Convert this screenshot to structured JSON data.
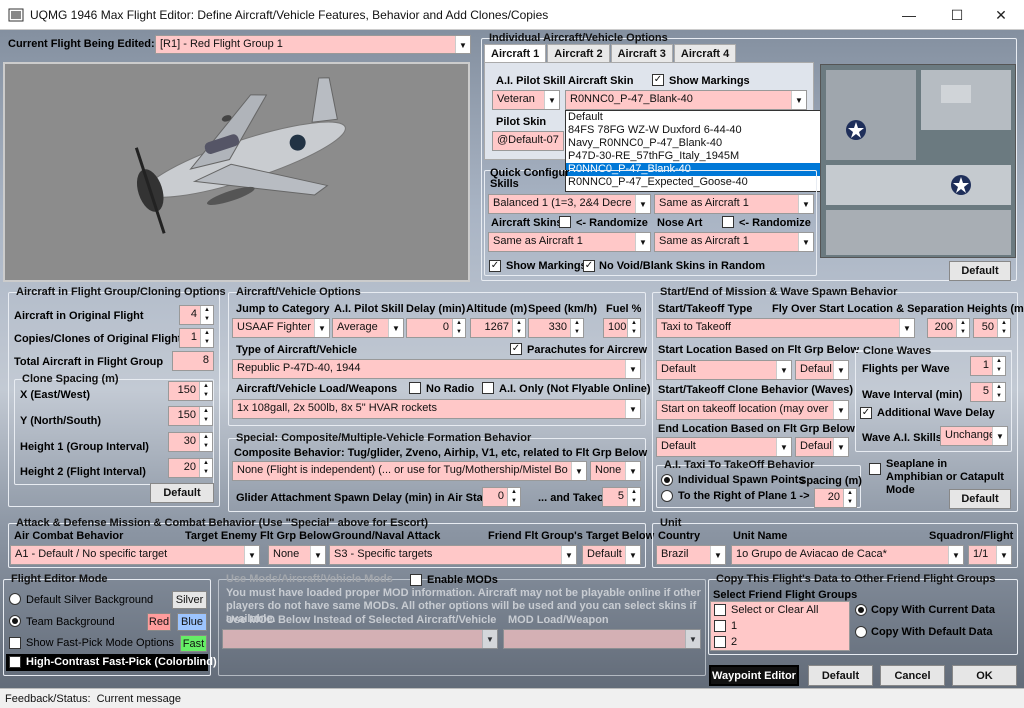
{
  "window": {
    "title": "UQMG 1946 Max Flight Editor:  Define Aircraft/Vehicle Features, Behavior and Add Clones/Copies",
    "minimize": "—",
    "maximize": "☐",
    "close": "✕"
  },
  "current_flight": {
    "label": "Current Flight Being Edited:",
    "value": "[R1] -  Red Flight Group  1"
  },
  "individual": {
    "title": "Individual Aircraft/Vehicle Options",
    "tabs": [
      "Aircraft 1",
      "Aircraft 2",
      "Aircraft 3",
      "Aircraft 4"
    ],
    "ai_skill_label": "A.I. Pilot Skill",
    "ai_skill": "Veteran",
    "skin_label": "Aircraft Skin",
    "show_markings": "Show Markings",
    "skin_value": "R0NNC0_P-47_Blank-40",
    "pilot_skin_label": "Pilot Skin",
    "pilot_skin": "@Default-07",
    "skin_options": [
      "Default",
      "84FS 78FG WZ-W Duxford 6-44-40",
      "Navy_R0NNC0_P-47_Blank-40",
      "P47D-30-RE_57thFG_Italy_1945M",
      "R0NNC0_P-47_Blank-40",
      "R0NNC0_P-47_Expected_Goose-40"
    ],
    "default_btn": "Default"
  },
  "quick": {
    "title": "Quick Configur",
    "skills": "Skills",
    "skills_val": "Balanced 1 (1=3, 2&4 Decre",
    "same1": "Same as Aircraft 1",
    "skins_label": "Aircraft Skins",
    "randomize": "<- Randomize",
    "skins_val": "Same as Aircraft 1",
    "nose_label": "Nose Art",
    "nose_val": "Same as Aircraft 1",
    "show_markings": "Show Markings",
    "no_void": "No Void/Blank Skins in Random"
  },
  "cloning": {
    "title": "Aircraft in Flight Group/Cloning Options",
    "orig_label": "Aircraft in Original Flight",
    "orig_val": "4",
    "copies_label": "Copies/Clones of Original Flight",
    "copies_val": "1",
    "total_label": "Total Aircraft in Flight Group",
    "total_val": "8",
    "spacing_title": "Clone Spacing (m)",
    "x_label": "X (East/West)",
    "x_val": "150",
    "y_label": "Y (North/South)",
    "y_val": "150",
    "h1_label": "Height 1 (Group Interval)",
    "h1_val": "30",
    "h2_label": "Height 2 (Flight Interval)",
    "h2_val": "20",
    "default_btn": "Default"
  },
  "vehicle": {
    "title": "Aircraft/Vehicle Options",
    "jump_label": "Jump to Category",
    "jump_val": "USAAF Fighter",
    "skill_label": "A.I. Pilot Skill",
    "skill_val": "Average",
    "delay_label": "Delay (min)",
    "delay_val": "0",
    "alt_label": "Altitude (m)",
    "alt_val": "1267",
    "speed_label": "Speed (km/h)",
    "speed_val": "330",
    "fuel_label": "Fuel %",
    "fuel_val": "100",
    "type_label": "Type of Aircraft/Vehicle",
    "parachutes": "Parachutes for Aircrew",
    "type_val": "Republic P-47D-40, 1944",
    "load_label": "Aircraft/Vehicle Load/Weapons",
    "no_radio": "No Radio",
    "ai_only": "A.I. Only (Not Flyable Online)",
    "load_val": "1x 108gall, 2x 500lb, 8x 5\" HVAR rockets"
  },
  "special": {
    "title": "Special: Composite/Multiple-Vehicle Formation Behavior",
    "sub": "Composite Behavior: Tug/glider, Zveno, Airhip, V1, etc, related to Flt Grp Below",
    "val": "None (Flight is independent) (... or use for Tug/Mothership/Mistel Bo",
    "none": "None",
    "glider_label": "Glider Attachment Spawn Delay (min) in Air Start",
    "glider_val": "0",
    "takeoff_label": "... and Takeoff",
    "takeoff_val": "5"
  },
  "spawn": {
    "title": "Start/End of Mission & Wave Spawn Behavior",
    "type_label": "Start/Takeoff Type",
    "fly_label": "Fly Over Start Location & Separation Heights (m)",
    "type_val": "Taxi to Takeoff",
    "h1": "200",
    "h2": "50",
    "start_loc_label": "Start Location Based on Flt Grp Below",
    "start_loc": "Default",
    "start_loc2": "Defaul",
    "clone_beh_label": "Start/Takeoff Clone Behavior (Waves)",
    "clone_beh": "Start on takeoff location (may over",
    "end_loc_label": "End Location Based on Flt Grp Below",
    "end_loc": "Default",
    "end_loc2": "Defaul",
    "waves_title": "Clone Waves",
    "fpw_label": "Flights per Wave",
    "fpw": "1",
    "wi_label": "Wave Interval (min)",
    "wi": "5",
    "additional": "Additional Wave Delay",
    "wave_skill_label": "Wave A.I. Skills",
    "wave_skill": "Unchange",
    "taxi_title": "A.I. Taxi To TakeOff Behavior",
    "ind": "Individual Spawn Points",
    "spacing": "Spacing (m)",
    "right": "To the Right of Plane 1 ->",
    "spacing_val": "20",
    "seaplane": "Seaplane in Amphibian or Catapult Mode",
    "default_btn": "Default"
  },
  "attack": {
    "title": "Attack & Defense Mission & Combat Behavior (Use \"Special\" above for Escort)",
    "air_label": "Air Combat Behavior",
    "target_label": "Target Enemy Flt Grp Below",
    "ground_label": "Ground/Naval Attack",
    "friend_label": "Friend Flt Group's Target Below",
    "air_val": "A1 - Default / No specific target",
    "target_val": "None",
    "ground_val": "S3 - Specific targets",
    "friend_val": "Default"
  },
  "unit": {
    "title": "Unit",
    "country_label": "Country",
    "name_label": "Unit Name",
    "squad_label": "Squadron/Flight",
    "country": "Brazil",
    "name": "1o Grupo de Aviacao de Caca*",
    "squad": "1/1"
  },
  "mode": {
    "title": "Flight Editor Mode",
    "silver_label": "Default Silver Background",
    "silver": "Silver",
    "team_label": "Team Background",
    "red": "Red",
    "blue": "Blue",
    "fast_label": "Show Fast-Pick Mode Options",
    "fast": "Fast",
    "hc_label": "High-Contrast Fast-Pick (Colorblind)",
    "fast_color": "#66ee66",
    "red_color": "#ff9c9c",
    "blue_color": "#9cc4ff"
  },
  "mods": {
    "title": "Use Mods/Aircraft/Vehicle Mods",
    "enable": "Enable MODs",
    "text": "You must have loaded proper MOD information. Aircraft may not be playable online if other players do not have same MODs. All other options will be used and you can select skins if available.",
    "use_label": "Use MOD Below Instead of Selected Aircraft/Vehicle",
    "load_label": "MOD Load/Weapon"
  },
  "copy": {
    "title": "Copy This Flight's Data to Other Friend Flight Groups",
    "select_label": "Select Friend Flight Groups",
    "items": [
      "Select or Clear All",
      "1",
      "2"
    ],
    "current": "Copy With Current Data",
    "default": "Copy With Default Data"
  },
  "buttons": {
    "waypoint": "Waypoint Editor",
    "default": "Default",
    "cancel": "Cancel",
    "ok": "OK"
  },
  "status": {
    "label": "Feedback/Status:",
    "value": "Current message"
  }
}
